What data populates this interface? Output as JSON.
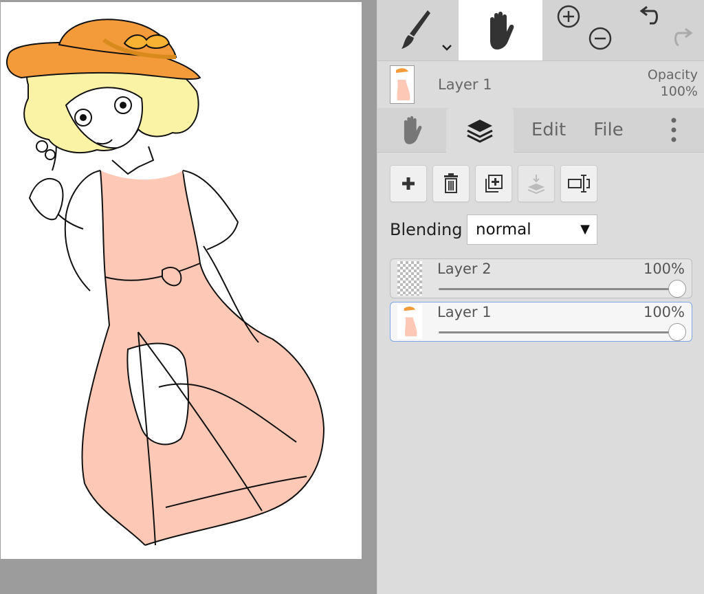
{
  "toolbar": {
    "tools": [
      {
        "name": "brush",
        "icon": "brush-icon",
        "has_dropdown": true
      },
      {
        "name": "hand",
        "icon": "hand-icon",
        "active": true
      },
      {
        "name": "zoom",
        "icons": [
          "zoom-in-icon",
          "zoom-out-icon"
        ]
      },
      {
        "name": "history",
        "icons": [
          "undo-icon",
          "redo-icon"
        ]
      }
    ]
  },
  "current_layer": {
    "name": "Layer 1",
    "opacity_label": "Opacity",
    "opacity_value": "100%"
  },
  "tabs": {
    "hand_icon": "hand-icon",
    "layers_icon": "layers-icon",
    "edit": "Edit",
    "file": "File",
    "more_icon": "more-vertical-icon"
  },
  "actions": [
    "add-layer-icon",
    "delete-layer-icon",
    "duplicate-layer-icon",
    "merge-down-icon",
    "rename-layer-icon"
  ],
  "blending": {
    "label": "Blending",
    "value": "normal"
  },
  "layers": [
    {
      "name": "Layer 2",
      "opacity": "100%",
      "opacity_level": 1.0,
      "selected": false
    },
    {
      "name": "Layer 1",
      "opacity": "100%",
      "opacity_level": 1.0,
      "selected": true
    }
  ],
  "colors": {
    "hat": "#f39a3a",
    "hair": "#faf3a6",
    "dress": "#fdc9b6",
    "active_tool_bg": "#ffffff",
    "selection_border": "#7fa6e0"
  }
}
